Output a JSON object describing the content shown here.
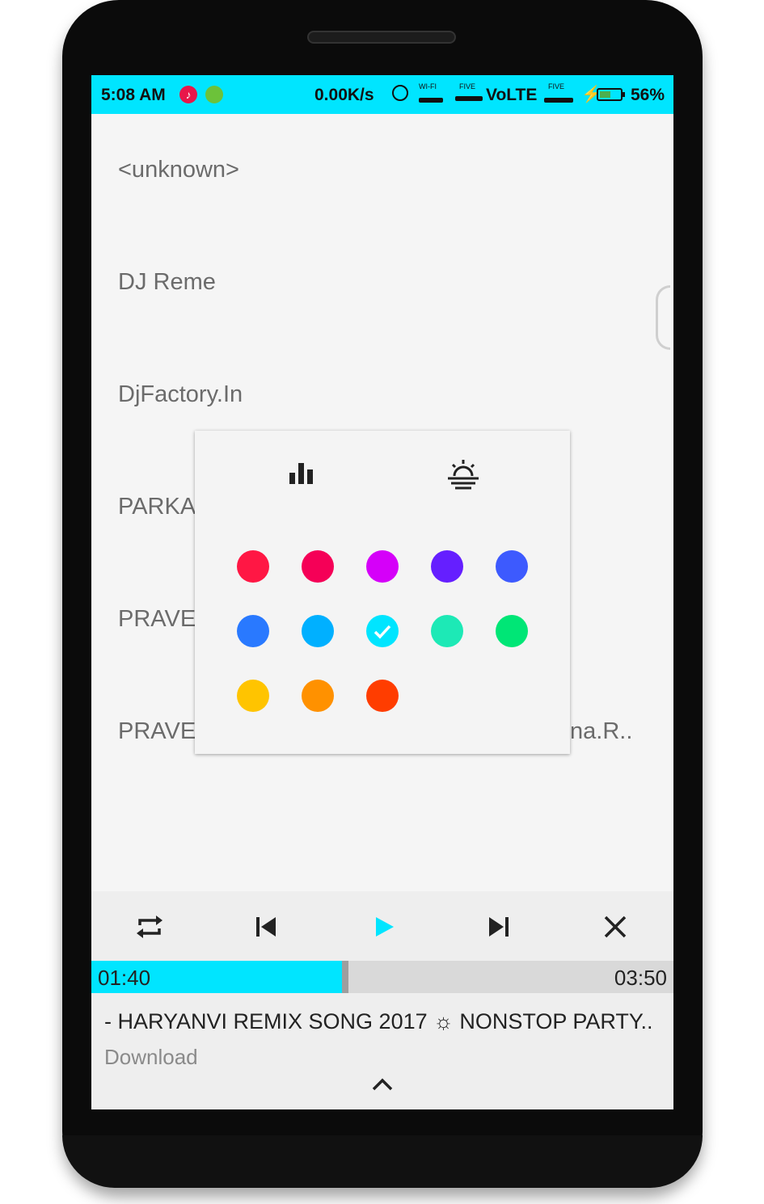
{
  "status_bar": {
    "time": "5:08 AM",
    "net_speed": "0.00K/s",
    "wifi_label": "WI-FI",
    "five_label_1": "FIVE",
    "volte": "VoLTE",
    "five_label_2": "FIVE",
    "battery": "56%",
    "battery_level": 0.56,
    "accent": "#00e5ff"
  },
  "list": {
    "items": [
      "<unknown>",
      "DJ Reme",
      "DjFactory.In",
      "PARKA",
      "PRAVE",
      "PRAVE"
    ],
    "trailing_fragment": "na.R.."
  },
  "color_picker": {
    "icons": [
      "bar-chart-icon",
      "sunrise-icon"
    ],
    "swatches": [
      {
        "color": "#ff1744",
        "selected": false
      },
      {
        "color": "#f50057",
        "selected": false
      },
      {
        "color": "#d500f9",
        "selected": false
      },
      {
        "color": "#651fff",
        "selected": false
      },
      {
        "color": "#3d5afe",
        "selected": false
      },
      {
        "color": "#2979ff",
        "selected": false
      },
      {
        "color": "#00b0ff",
        "selected": false
      },
      {
        "color": "#00e5ff",
        "selected": true
      },
      {
        "color": "#1de9b6",
        "selected": false
      },
      {
        "color": "#00e676",
        "selected": false
      },
      {
        "color": "#ffc400",
        "selected": false
      },
      {
        "color": "#ff9100",
        "selected": false
      },
      {
        "color": "#ff3d00",
        "selected": false
      }
    ]
  },
  "player": {
    "controls": [
      "repeat-icon",
      "previous-icon",
      "play-icon",
      "next-icon",
      "close-icon"
    ],
    "current_time": "01:40",
    "total_time": "03:50",
    "progress": 0.43,
    "title": "- HARYANVI REMIX SONG 2017 ☼ NONSTOP PARTY..",
    "subtitle": "Download"
  }
}
